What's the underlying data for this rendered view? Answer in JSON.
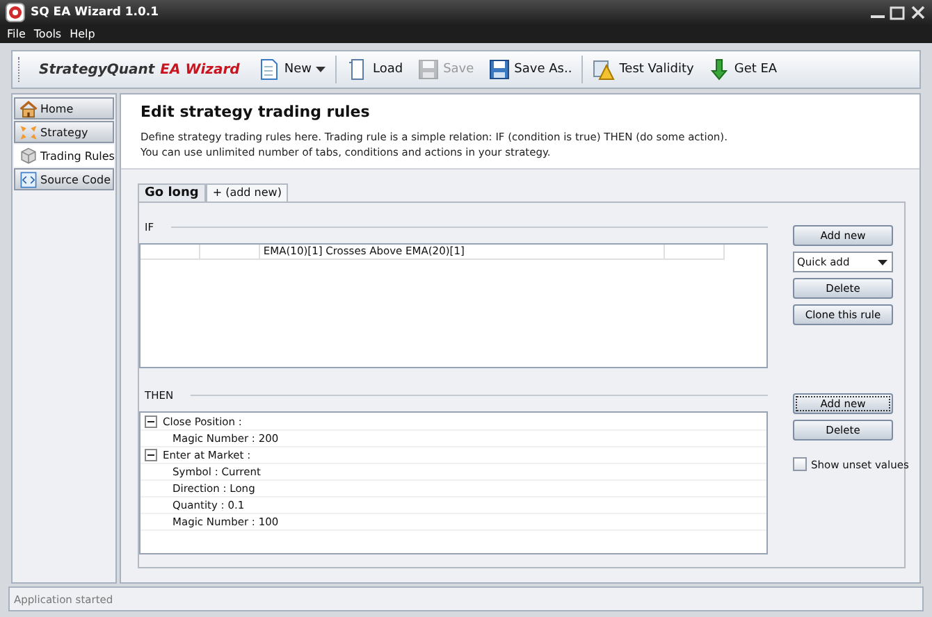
{
  "window": {
    "title": "SQ EA Wizard 1.0.1"
  },
  "menu": [
    "File",
    "Tools",
    "Help"
  ],
  "toolbar": {
    "logo": "StrategyQuant",
    "logo_suffix": "EA Wizard",
    "items": [
      {
        "label": "New",
        "kind": "dropdown",
        "disabled": false
      },
      {
        "label": "Load",
        "kind": "button",
        "disabled": false
      },
      {
        "label": "Save",
        "kind": "button",
        "disabled": true
      },
      {
        "label": "Save As..",
        "kind": "button",
        "disabled": false
      },
      {
        "label": "Test Validity",
        "kind": "button",
        "disabled": false
      },
      {
        "label": "Get EA",
        "kind": "button",
        "disabled": false
      }
    ]
  },
  "sidebar": {
    "items": [
      {
        "label": "Home",
        "selected": false
      },
      {
        "label": "Strategy",
        "selected": false
      },
      {
        "label": "Trading Rules",
        "selected": true
      },
      {
        "label": "Source Code",
        "selected": false
      }
    ]
  },
  "header": {
    "title": "Edit strategy trading rules",
    "lines": [
      "Define strategy trading rules here. Trading rule is a simple relation: IF (condition is true) THEN (do some action).",
      "You can use unlimited number of tabs, conditions and actions in your strategy."
    ]
  },
  "tabs": [
    {
      "label": "Go long",
      "selected": true
    },
    {
      "label": "+ (add new)",
      "selected": false
    }
  ],
  "if_section": {
    "label": "IF",
    "rules": [
      {
        "condition": "EMA(10)[1] Crosses Above EMA(20)[1]"
      }
    ],
    "controls": [
      {
        "kind": "button",
        "label": "Add new"
      },
      {
        "kind": "select",
        "label": "Quick add"
      },
      {
        "kind": "button",
        "label": "Delete"
      },
      {
        "kind": "button",
        "label": "Clone this rule"
      }
    ]
  },
  "then_section": {
    "label": "THEN",
    "actions": [
      {
        "label": "Close Position :",
        "expanded": true,
        "children": [
          {
            "label": "Magic Number : 200"
          }
        ]
      },
      {
        "label": "Enter at Market :",
        "expanded": true,
        "children": [
          {
            "label": "Symbol : Current"
          },
          {
            "label": "Direction : Long"
          },
          {
            "label": "Quantity : 0.1"
          },
          {
            "label": "Magic Number : 100"
          }
        ]
      }
    ],
    "controls": [
      {
        "kind": "button",
        "label": "Add new",
        "focused": true
      },
      {
        "kind": "button",
        "label": "Delete",
        "focused": false
      },
      {
        "kind": "checkbox",
        "label": "Show unset values",
        "checked": false
      }
    ]
  },
  "status_bar": "Application started"
}
